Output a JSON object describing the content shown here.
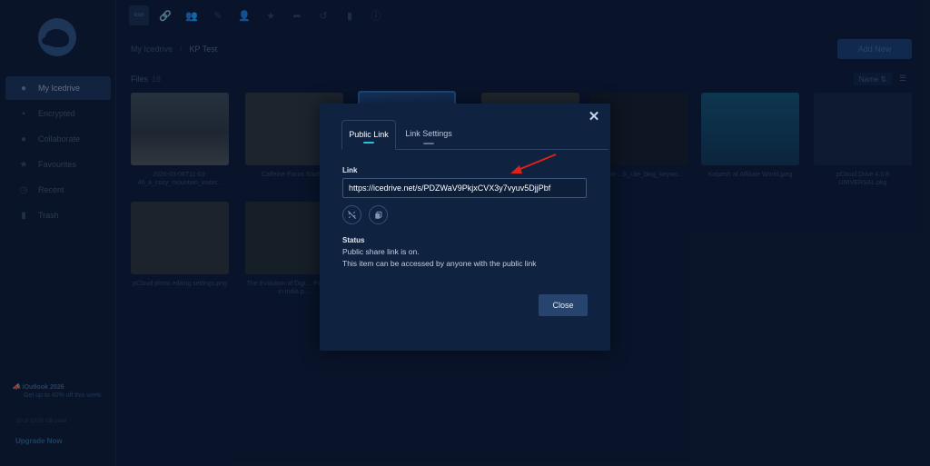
{
  "app": {
    "logo": "icedrive-dog-logo",
    "accent": "#27c2d6",
    "annotation_color": "#e0201a"
  },
  "sidebar": {
    "items": [
      {
        "label": "My Icedrive",
        "icon": "user-icon",
        "active": true
      },
      {
        "label": "Encrypted",
        "icon": "lock-icon"
      },
      {
        "label": "Collaborate",
        "icon": "people-icon"
      },
      {
        "label": "Favourites",
        "icon": "star-icon"
      },
      {
        "label": "Recent",
        "icon": "clock-icon"
      },
      {
        "label": "Trash",
        "icon": "trash-icon"
      }
    ],
    "promo_title": "iOutlook 2026",
    "promo_text": "Get up to 40% off this week",
    "storage": "10 of 10.00 GB used",
    "upgrade": "Upgrade Now"
  },
  "toolbar": {
    "selected_label": "Icon",
    "icons": [
      "link-icon",
      "share-user-icon",
      "pencil-icon",
      "person-icon",
      "star-icon",
      "forward-icon",
      "history-icon",
      "trash-icon",
      "info-icon"
    ]
  },
  "breadcrumb": {
    "root": "My Icedrive",
    "current": "KP Test"
  },
  "header": {
    "add_new": "Add New",
    "files_label": "Files",
    "files_count": "18",
    "sort": "Name ⇅",
    "list_icon": "☰"
  },
  "files": [
    {
      "name": "2026-03-06T11-03-46_a_cozy_mountain_water..."
    },
    {
      "name": "Caffeine Focus Study..."
    },
    {
      "name": ""
    },
    {
      "name": ""
    },
    {
      "name": "gemini-…h_Lite_blog_keywo..."
    },
    {
      "name": "Kalpesh at Affiliate World.jpeg"
    },
    {
      "name": "pCloud Drive 4.0.8 UNIVERSAL.pkg"
    },
    {
      "name": "pCloud photo editing settings.png"
    },
    {
      "name": "The Evolution of Digi… Payments in India.p…"
    }
  ],
  "modal": {
    "tabs": [
      {
        "label": "Public Link",
        "active": true
      },
      {
        "label": "Link Settings",
        "active": false
      }
    ],
    "link_label": "Link",
    "link_value": "https://icedrive.net/s/PDZWaV9PkjxCVX3y7vyuv5DjjPbf",
    "status_label": "Status",
    "status_line1": "Public share link is on.",
    "status_line2": "This item can be accessed by anyone with the public link",
    "close_label": "Close"
  }
}
